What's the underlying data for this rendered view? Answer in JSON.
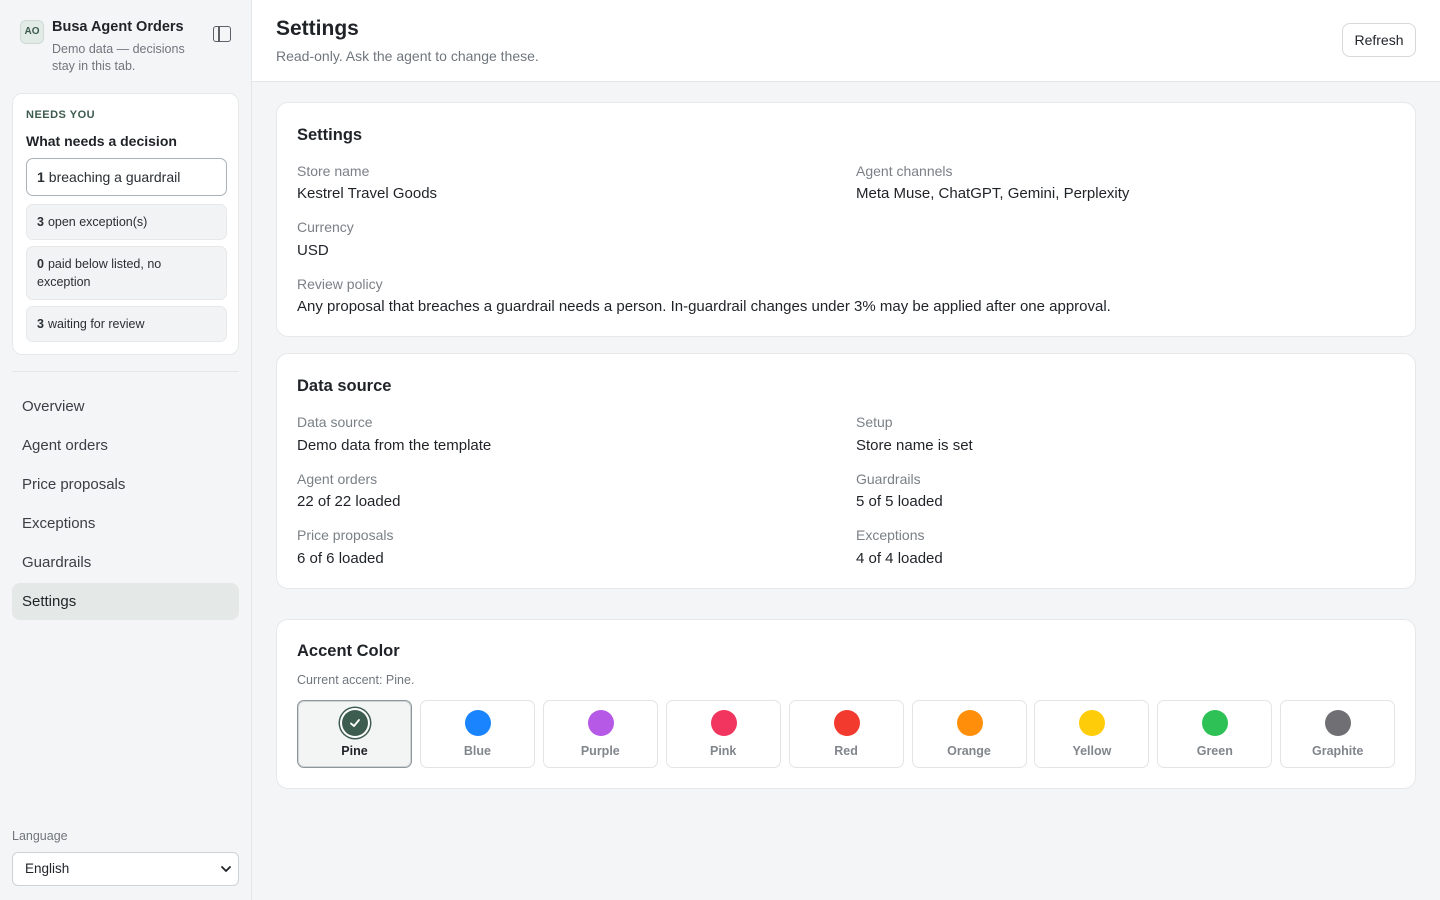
{
  "brand": {
    "avatar": "AO",
    "title": "Busa Agent Orders",
    "subtitle": "Demo data — decisions stay in this tab."
  },
  "needs": {
    "kicker": "NEEDS YOU",
    "title": "What needs a decision",
    "items": [
      {
        "count": "1",
        "label": "breaching a guardrail"
      },
      {
        "count": "3",
        "label": "open exception(s)"
      },
      {
        "count": "0",
        "label": "paid below listed, no exception"
      },
      {
        "count": "3",
        "label": "waiting for review"
      }
    ]
  },
  "nav": [
    "Overview",
    "Agent orders",
    "Price proposals",
    "Exceptions",
    "Guardrails",
    "Settings"
  ],
  "nav_active": "Settings",
  "language": {
    "label": "Language",
    "value": "English"
  },
  "header": {
    "title": "Settings",
    "subtitle": "Read-only. Ask the agent to change these.",
    "refresh": "Refresh"
  },
  "settings_card": {
    "title": "Settings",
    "store_name_label": "Store name",
    "store_name": "Kestrel Travel Goods",
    "channels_label": "Agent channels",
    "channels": "Meta Muse, ChatGPT, Gemini, Perplexity",
    "currency_label": "Currency",
    "currency": "USD",
    "review_label": "Review policy",
    "review": "Any proposal that breaches a guardrail needs a person. In-guardrail changes under 3% may be applied after one approval."
  },
  "data_source_card": {
    "title": "Data source",
    "source_label": "Data source",
    "source": "Demo data from the template",
    "setup_label": "Setup",
    "setup": "Store name is set",
    "orders_label": "Agent orders",
    "orders": "22 of 22 loaded",
    "guardrails_label": "Guardrails",
    "guardrails": "5 of 5 loaded",
    "proposals_label": "Price proposals",
    "proposals": "6 of 6 loaded",
    "exceptions_label": "Exceptions",
    "exceptions": "4 of 4 loaded"
  },
  "accent": {
    "title": "Accent Color",
    "current": "Current accent: Pine.",
    "selected": "Pine",
    "options": [
      {
        "name": "Pine",
        "color": "#3e5d51"
      },
      {
        "name": "Blue",
        "color": "#1a84ff"
      },
      {
        "name": "Purple",
        "color": "#b659e6"
      },
      {
        "name": "Pink",
        "color": "#f2355e"
      },
      {
        "name": "Red",
        "color": "#f23a2e"
      },
      {
        "name": "Orange",
        "color": "#ff8f0a"
      },
      {
        "name": "Yellow",
        "color": "#ffcc0a"
      },
      {
        "name": "Green",
        "color": "#2ec256"
      },
      {
        "name": "Graphite",
        "color": "#707074"
      }
    ]
  }
}
